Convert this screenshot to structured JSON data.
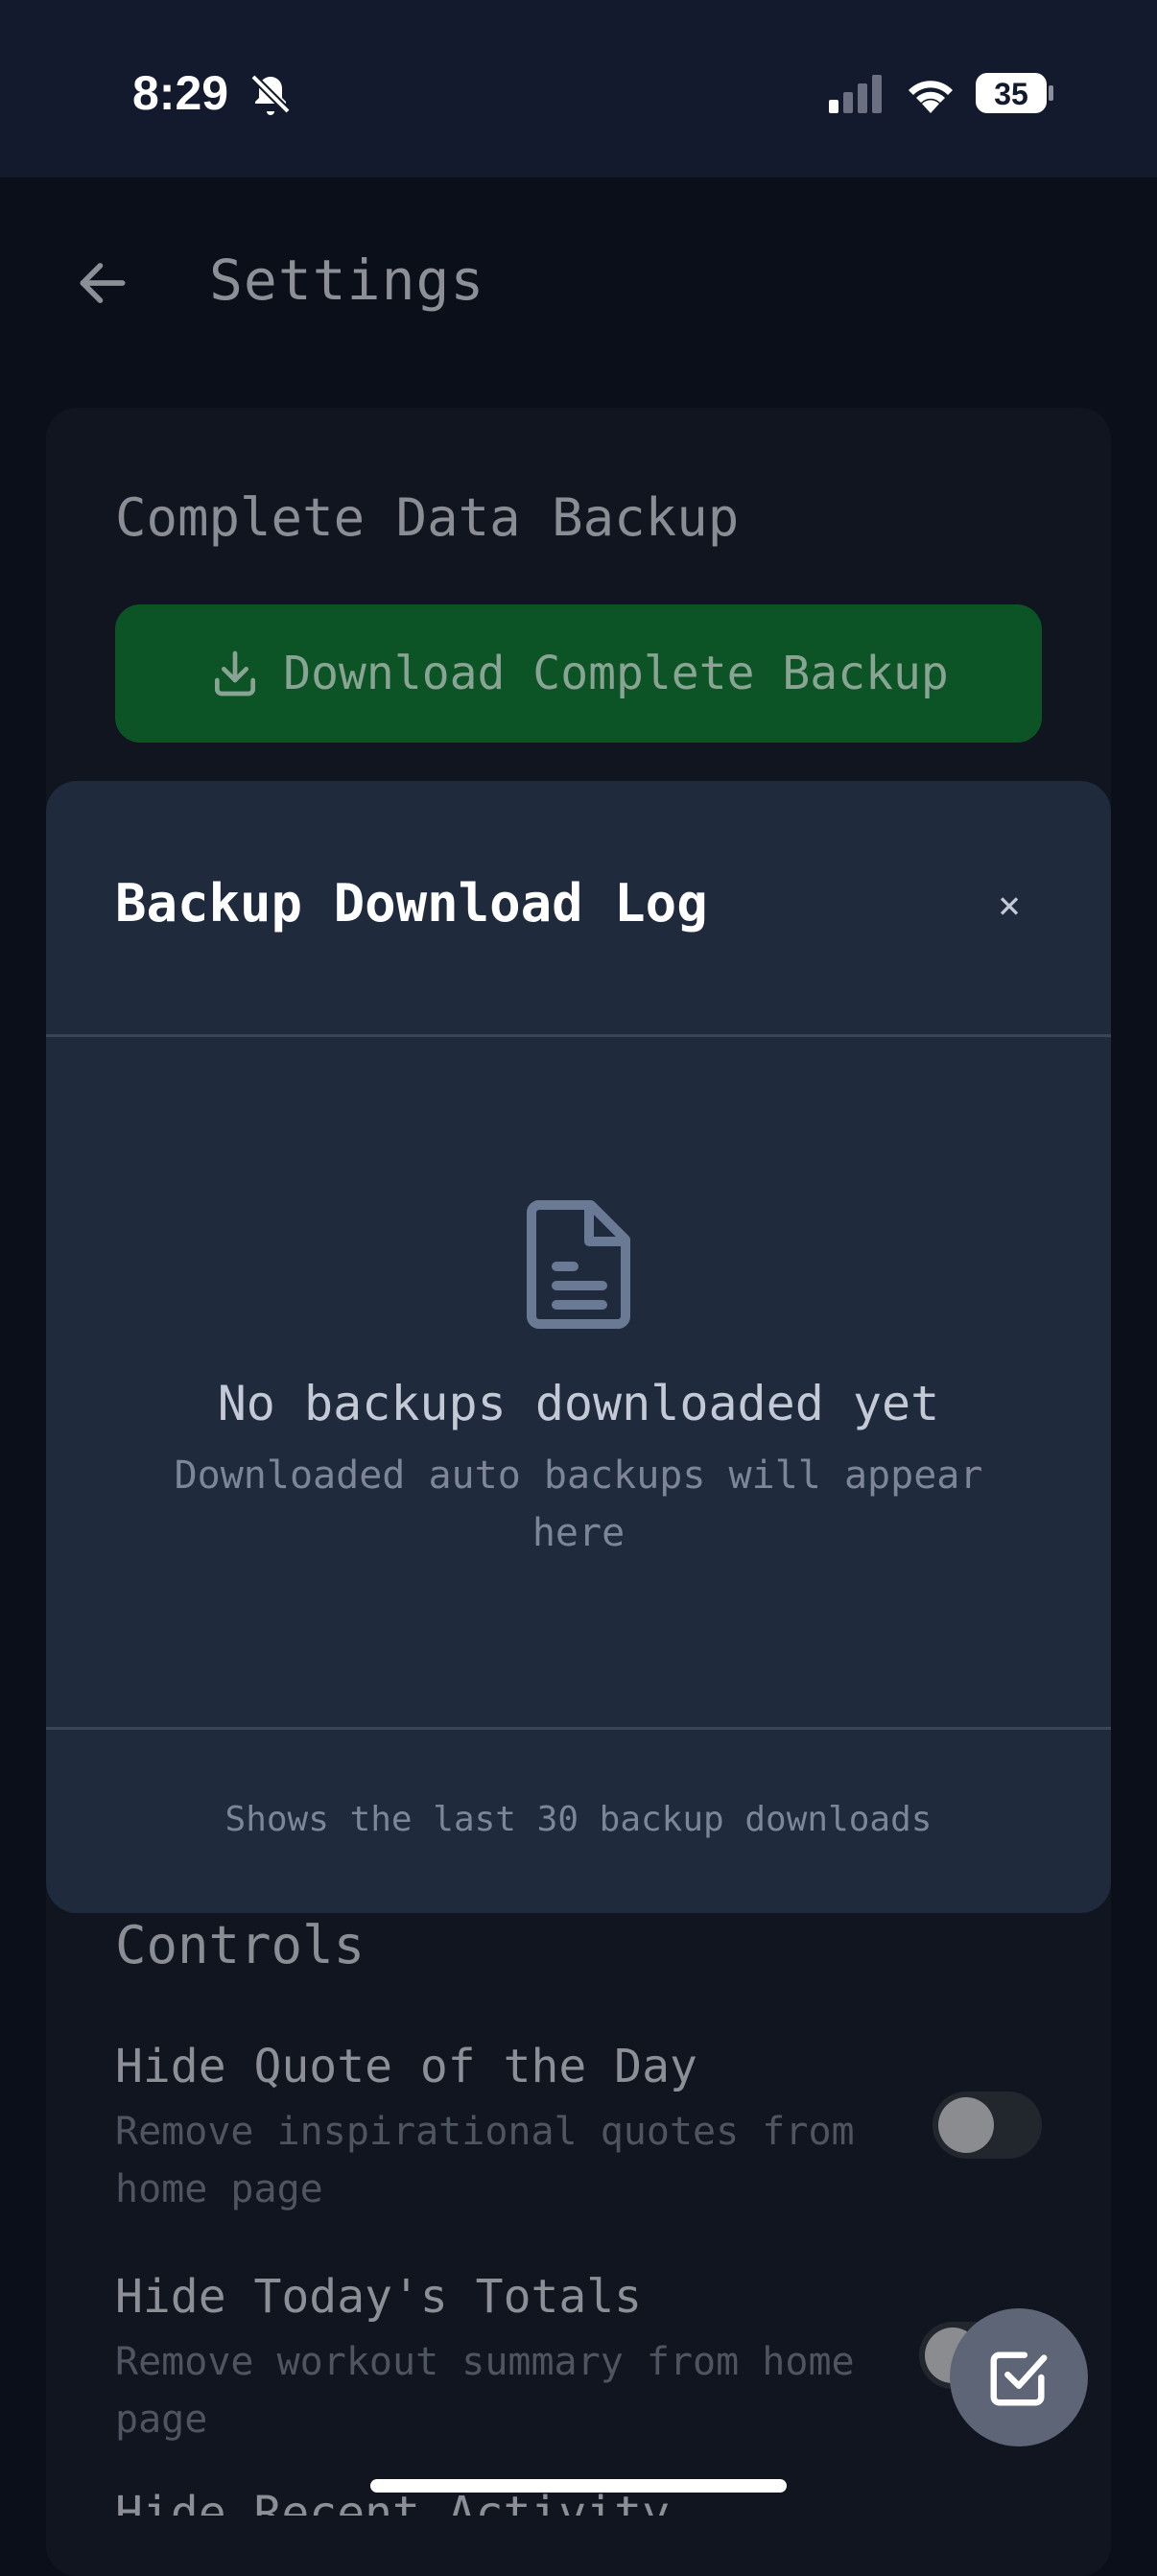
{
  "status": {
    "time": "8:29",
    "battery": "35"
  },
  "header": {
    "title": "Settings"
  },
  "backup": {
    "section_title": "Complete Data Backup",
    "download_label": "Download Complete Backup"
  },
  "modal": {
    "title": "Backup Download Log",
    "close": "×",
    "empty_title": "No backups downloaded yet",
    "empty_subtitle": "Downloaded auto backups will appear here",
    "footer": "Shows the last 30 backup downloads"
  },
  "controls": {
    "section_title": "Controls",
    "items": [
      {
        "title": "Hide Quote of the Day",
        "subtitle": "Remove inspirational quotes from home page",
        "enabled": false
      },
      {
        "title": "Hide Today's Totals",
        "subtitle": "Remove workout summary from home page",
        "enabled": false
      },
      {
        "title": "Hide Recent Activity"
      }
    ]
  },
  "colors": {
    "accent_green": "#0c5426",
    "modal_bg": "#1f2a3d",
    "page_bg": "#0b0f19"
  }
}
